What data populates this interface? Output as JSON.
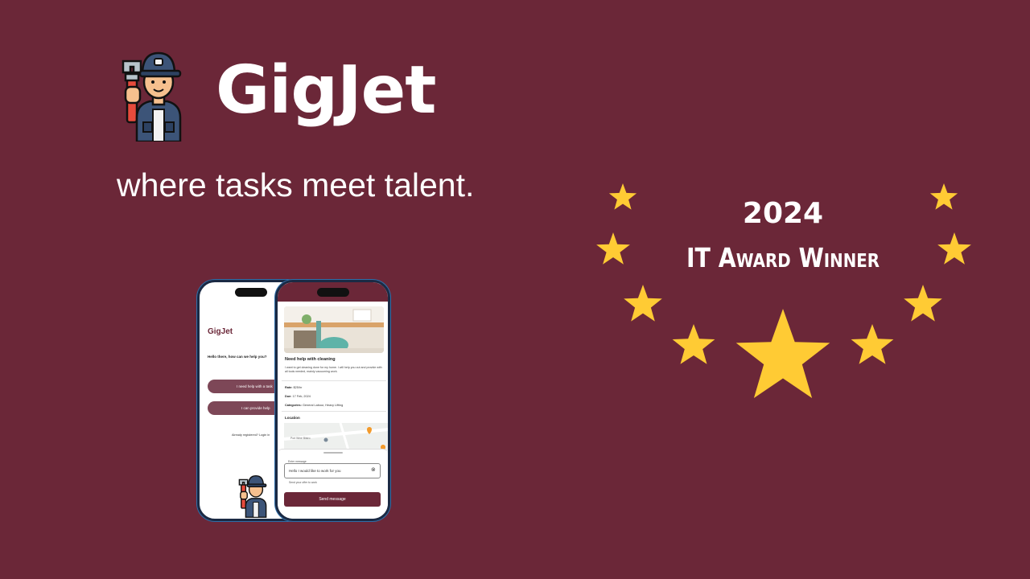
{
  "brand": {
    "name": "GigJet",
    "tagline": "where tasks meet talent.",
    "logo_icon": "plumber-mascot-icon"
  },
  "award": {
    "year": "2024",
    "title": "IT Award Winner",
    "star_icon": "star-icon",
    "star_color": "#ffcb34"
  },
  "colors": {
    "background": "#6b2738",
    "accent": "#7d4757",
    "text": "#ffffff"
  },
  "phone_home": {
    "app_title": "GigJet",
    "greeting": "Hello there, how can we help you?",
    "need_help_label": "I need help with a task",
    "provide_help_label": "I can provide help",
    "login_prompt": "Already registered? Login in"
  },
  "phone_task": {
    "heading": "Need help with cleaning",
    "description": "I want to get cleaning done for my home. I will help you out and provide with all tools needed, mainly vacuuming work.",
    "rate_label": "Rate:",
    "rate_value": "$25/hr",
    "date_label": "Due:",
    "date_value": "17 Feb, 2024",
    "categories_label": "Categories:",
    "categories_value": "General Labour, Heavy Lifting",
    "location_label": "Location",
    "map_place": "Port Wine Bistro",
    "message_label": "Enter message",
    "message_value": "Hello I would like to work for you",
    "helper_text": "Send your offer to work",
    "send_label": "Send message",
    "clear_icon": "clear-circle-icon"
  }
}
